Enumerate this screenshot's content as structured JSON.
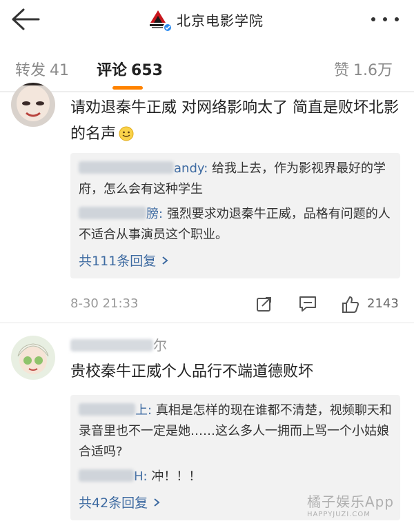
{
  "header": {
    "title": "北京电影学院"
  },
  "tabs": [
    {
      "label": "转发",
      "count": "41"
    },
    {
      "label": "评论",
      "count": "653"
    },
    {
      "label": "赞",
      "count": "1.6万"
    }
  ],
  "comments": [
    {
      "text": "请劝退秦牛正威 对网络影响太了 简直是败坏北影的名声",
      "replies": [
        {
          "name_visible": "andy:",
          "text": "给我上去，作为影视界最好的学府，怎么会有这种学生"
        },
        {
          "name_visible": "膀:",
          "text": "强烈要求劝退秦牛正威，品格有问题的人不适合从事演员这个职业。"
        }
      ],
      "more_replies": "共111条回复",
      "time": "8-30 21:33",
      "likes": "2143"
    },
    {
      "name_visible": "尔",
      "text": "贵校秦牛正威个人品行不端道德败坏",
      "replies": [
        {
          "name_visible": "上:",
          "text": "真相是怎样的现在谁都不清楚，视频聊天和录音里也不一定是她……这么多人一拥而上骂一个小姑娘合适吗?"
        },
        {
          "name_visible": "H:",
          "text": "冲！！！"
        }
      ],
      "more_replies": "共42条回复"
    }
  ],
  "watermark": {
    "main": "橘子娱乐App",
    "sub": "HAPPYJUZI.COM"
  },
  "colors": {
    "accent": "#ff8200",
    "link": "#3d6aa1",
    "reply_bg": "#f2f2f2",
    "verified": "#2d8cf0"
  },
  "icons": [
    "back-arrow-icon",
    "school-logo",
    "verified-badge-icon",
    "more-icon",
    "repost-icon",
    "comment-icon",
    "like-icon",
    "chevron-right-icon",
    "smile-emoji-icon"
  ]
}
